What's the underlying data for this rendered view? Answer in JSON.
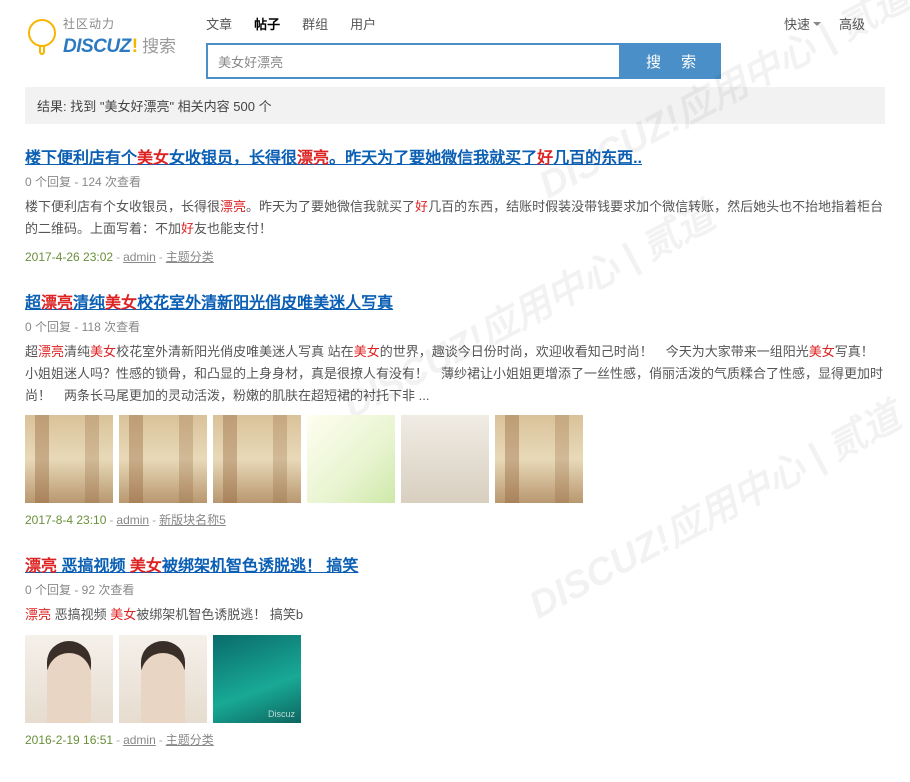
{
  "logo": {
    "sub": "社区动力",
    "brand": "DISCUZ",
    "excl": "!",
    "search_label": "搜索"
  },
  "nav": {
    "tabs": [
      "文章",
      "帖子",
      "群组",
      "用户"
    ],
    "active_index": 1,
    "quick": "快速",
    "advanced": "高级"
  },
  "search": {
    "value": "美女好漂亮",
    "button": "搜 索"
  },
  "result_summary": "结果: 找到 \"美女好漂亮\" 相关内容 500 个",
  "results": [
    {
      "title_parts": [
        "楼下便利店有个",
        "美女",
        "女收银员，长得很",
        "漂亮",
        "。昨天为了要她微信我就买了",
        "好",
        "几百的东西.."
      ],
      "meta": "0 个回复 - 124 次查看",
      "snippet_parts": [
        "楼下便利店有个女收银员，长得很",
        "漂亮",
        "。昨天为了要她微信我就买了",
        "好",
        "几百的东西，结账时假装没带钱要求加个微信转账，然后她头也不抬地指着柜台的二维码。上面写着：不加",
        "好",
        "友也能支付！"
      ],
      "date": "2017-4-26 23:02",
      "author": "admin",
      "category": "主题分类"
    },
    {
      "title_parts": [
        "超",
        "漂亮",
        "清纯",
        "美女",
        "校花室外清新阳光俏皮唯美迷人写真"
      ],
      "meta": "0 个回复 - 118 次查看",
      "snippet_parts": [
        "超",
        "漂亮",
        "清纯",
        "美女",
        "校花室外清新阳光俏皮唯美迷人写真 站在",
        "美女",
        "的世界，趣谈今日份时尚，欢迎收看知己时尚！　今天为大家带来一组阳光",
        "美女",
        "写真！　小姐姐迷人吗？性感的锁骨，和凸显的上身身材，真是很撩人有没有！　薄纱裙让小姐姐更增添了一丝性感，俏丽活泼的气质糅合了性感，显得更加时尚！　两条长马尾更加的灵动活泼，粉嫩的肌肤在超短裙的衬托下非 ..."
      ],
      "thumbs": [
        "t-campus",
        "t-campus",
        "t-campus",
        "t-bright",
        "t-portrait",
        "t-campus"
      ],
      "date": "2017-8-4 23:10",
      "author": "admin",
      "category": "新版块名称5"
    },
    {
      "title_parts": [
        "漂亮",
        " 恶搞视频 ",
        "美女",
        "被绑架机智色诱脱逃！  搞笑"
      ],
      "meta": "0 个回复 - 92 次查看",
      "snippet_parts": [
        "漂亮",
        " 恶搞视频 ",
        "美女",
        "被绑架机智色诱脱逃！  搞笑b"
      ],
      "thumbs": [
        "t-girl",
        "t-girl",
        "t-water"
      ],
      "date": "2016-2-19 16:51",
      "author": "admin",
      "category": "主题分类"
    }
  ],
  "thumb_watermark": "Discuz"
}
